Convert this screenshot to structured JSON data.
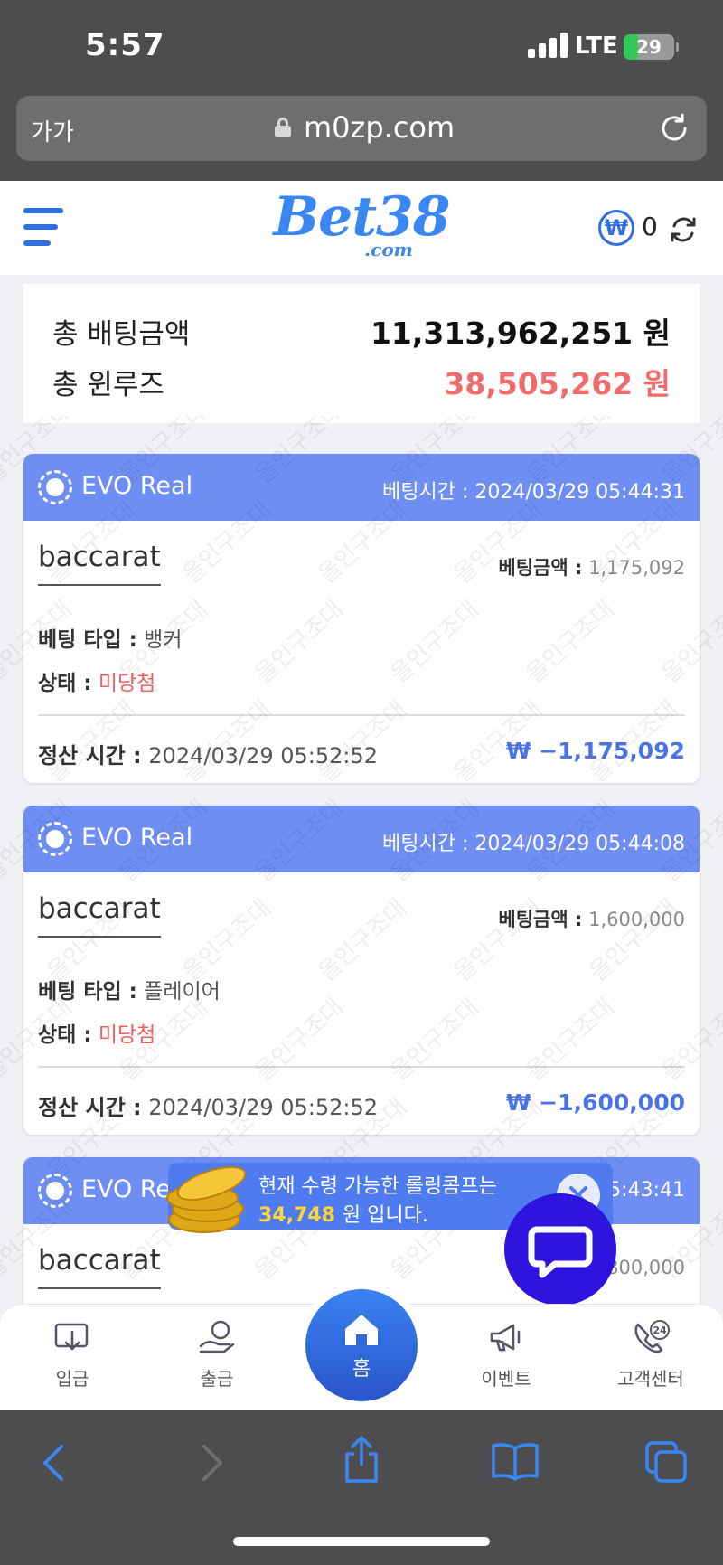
{
  "status_bar": {
    "time": "5:57",
    "network": "LTE",
    "battery_level": 29,
    "battery_text": "29"
  },
  "browser": {
    "text_size_label": "가가",
    "url": "m0zp.com"
  },
  "header": {
    "logo_text": "Bet38",
    "logo_sub": ".com",
    "currency_symbol": "₩",
    "balance": "0"
  },
  "summary": {
    "total_bet_label": "총 배팅금액",
    "total_bet_value": "11,313,962,251 원",
    "total_winlose_label": "총 윈루즈",
    "total_winlose_value": "38,505,262 원"
  },
  "labels": {
    "bet_time": "베팅시간 :",
    "bet_amount": "베팅금액 :",
    "bet_type": "베팅 타입 :",
    "status": "상태 :",
    "settle_time": "정산 시간 :"
  },
  "bets": [
    {
      "provider": "EVO Real",
      "bet_time": "2024/03/29 05:44:31",
      "game": "baccarat",
      "amount": "1,175,092",
      "bet_type": "뱅커",
      "status": "미당첨",
      "settle_time": "2024/03/29 05:52:52",
      "result": "₩ −1,175,092"
    },
    {
      "provider": "EVO Real",
      "bet_time": "2024/03/29 05:44:08",
      "game": "baccarat",
      "amount": "1,600,000",
      "bet_type": "플레이어",
      "status": "미당첨",
      "settle_time": "2024/03/29 05:52:52",
      "result": "₩ −1,600,000"
    },
    {
      "provider": "EVO Re",
      "bet_time_partial": "05:43:41",
      "game": "baccarat",
      "amount_partial": "800,000"
    }
  ],
  "toast": {
    "line1": "현재 수령 가능한 롤링콤프는",
    "amount": "34,748",
    "line2_suffix": "원 입니다."
  },
  "watermark_text": "올인구조대",
  "bottom_nav": {
    "deposit": "입금",
    "withdraw": "출금",
    "home": "홈",
    "event": "이벤트",
    "support": "고객센터",
    "support_badge": "24"
  },
  "colors": {
    "brand_blue": "#3a86f2",
    "card_header": "#6f8ef3",
    "loss_red": "#f06060",
    "result_blue": "#4b73e8",
    "chat_button": "#2f14e0",
    "toast_bg": "#4e7bef",
    "toast_amount": "#ffd43b"
  }
}
